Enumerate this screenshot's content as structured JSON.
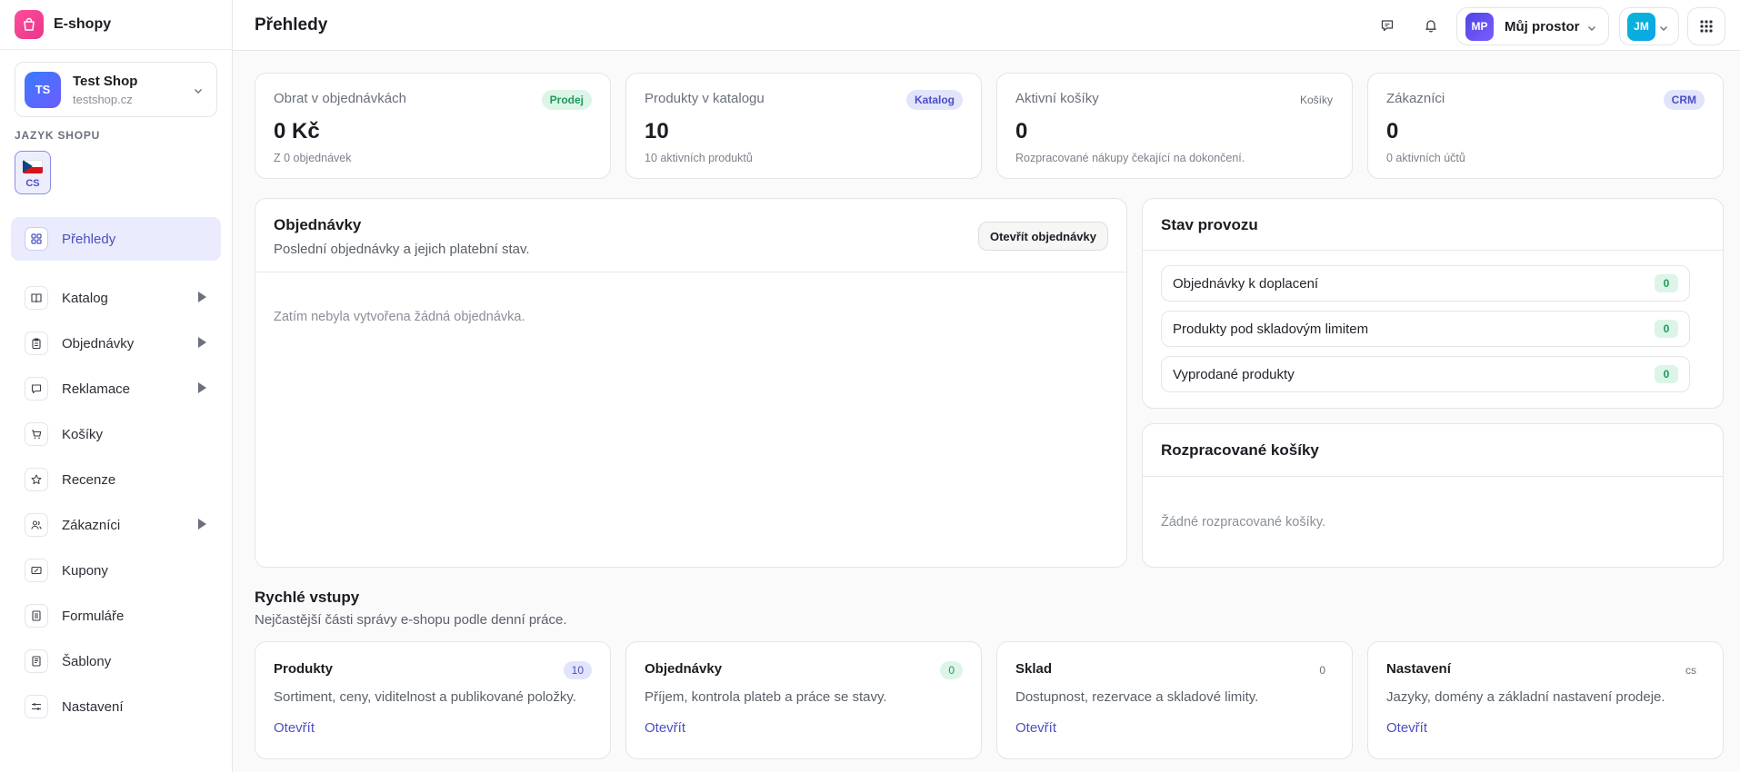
{
  "brand": {
    "name": "E-shopy",
    "icon": "shopping-bag-icon"
  },
  "shop": {
    "initials": "TS",
    "name": "Test Shop",
    "domain": "testshop.cz"
  },
  "language": {
    "label": "JAZYK SHOPU",
    "code": "CS"
  },
  "sidebar": {
    "items": [
      {
        "label": "Přehledy",
        "icon": "grid-icon",
        "active": true,
        "expandable": false
      },
      {
        "label": "Katalog",
        "icon": "book-icon",
        "expandable": true
      },
      {
        "label": "Objednávky",
        "icon": "clipboard-icon",
        "expandable": true
      },
      {
        "label": "Reklamace",
        "icon": "message-icon",
        "expandable": true
      },
      {
        "label": "Košíky",
        "icon": "cart-icon",
        "expandable": false
      },
      {
        "label": "Recenze",
        "icon": "star-icon",
        "expandable": false
      },
      {
        "label": "Zákazníci",
        "icon": "users-icon",
        "expandable": true
      },
      {
        "label": "Kupony",
        "icon": "ticket-icon",
        "expandable": false
      },
      {
        "label": "Formuláře",
        "icon": "form-icon",
        "expandable": false
      },
      {
        "label": "Šablony",
        "icon": "template-icon",
        "expandable": false
      },
      {
        "label": "Nastavení",
        "icon": "sliders-icon",
        "expandable": false
      }
    ]
  },
  "header": {
    "title": "Přehledy",
    "workspace": {
      "initials": "MP",
      "name": "Můj prostor"
    },
    "user": {
      "initials": "JM"
    }
  },
  "stats": [
    {
      "label": "Obrat v objednávkách",
      "badge": "Prodej",
      "value": "0 Kč",
      "sub": "Z 0 objednávek"
    },
    {
      "label": "Produkty v katalogu",
      "badge": "Katalog",
      "value": "10",
      "sub": "10 aktivních produktů"
    },
    {
      "label": "Aktivní košíky",
      "badge": "Košíky",
      "value": "0",
      "sub": "Rozpracované nákupy čekající na dokončení."
    },
    {
      "label": "Zákazníci",
      "badge": "CRM",
      "value": "0",
      "sub": "0 aktivních účtů"
    }
  ],
  "orders": {
    "title": "Objednávky",
    "subtitle": "Poslední objednávky a jejich platební stav.",
    "button": "Otevřít objednávky",
    "empty": "Zatím nebyla vytvořena žádná objednávka."
  },
  "operations": {
    "title": "Stav provozu",
    "rows": [
      {
        "label": "Objednávky k doplacení",
        "count": "0"
      },
      {
        "label": "Produkty pod skladovým limitem",
        "count": "0"
      },
      {
        "label": "Vyprodané produkty",
        "count": "0"
      }
    ]
  },
  "carts": {
    "title": "Rozpracované košíky",
    "empty": "Žádné rozpracované košíky."
  },
  "quick": {
    "title": "Rychlé vstupy",
    "subtitle": "Nejčastější části správy e-shopu podle denní práce.",
    "cards": [
      {
        "title": "Produkty",
        "badge": "10",
        "desc": "Sortiment, ceny, viditelnost a publikované položky.",
        "link": "Otevřít"
      },
      {
        "title": "Objednávky",
        "badge": "0",
        "desc": "Příjem, kontrola plateb a práce se stavy.",
        "link": "Otevřít"
      },
      {
        "title": "Sklad",
        "badge": "0",
        "desc": "Dostupnost, rezervace a skladové limity.",
        "link": "Otevřít"
      },
      {
        "title": "Nastavení",
        "badge": "cs",
        "desc": "Jazyky, domény a základní nastavení prodeje.",
        "link": "Otevřít"
      }
    ]
  },
  "colors": {
    "accent": "#4b4fc4",
    "accent_bg": "#eaebfc",
    "success": "#1e9a5a",
    "success_bg": "#dcf5e8",
    "brand": "#e8368a"
  }
}
